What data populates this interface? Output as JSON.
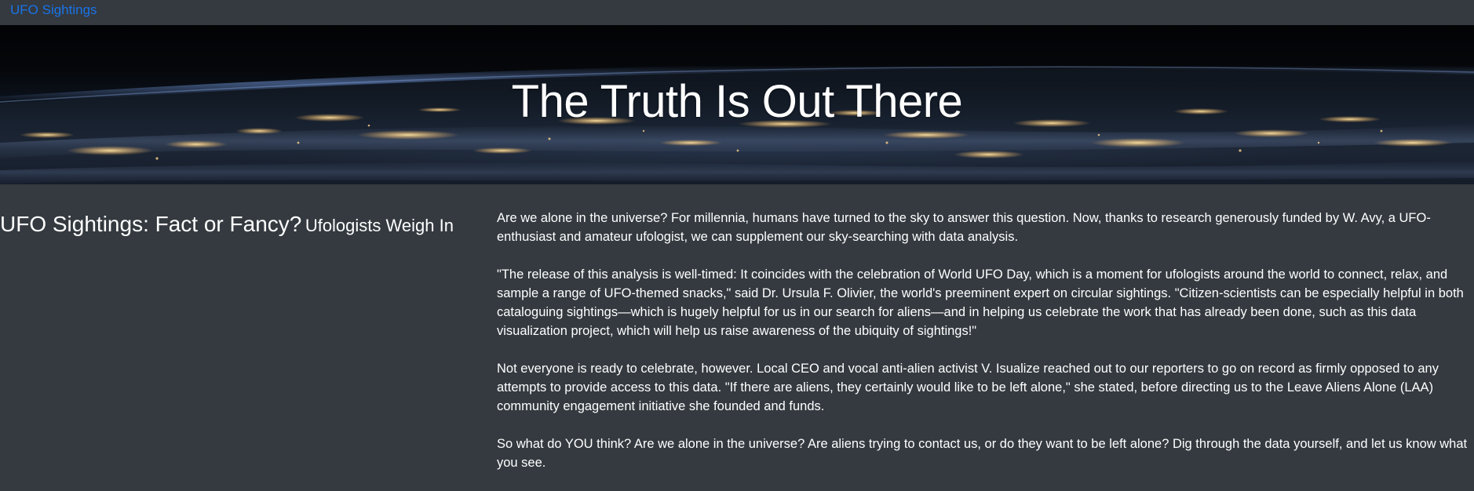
{
  "navbar": {
    "brand": "UFO Sightings"
  },
  "hero": {
    "title": "The Truth Is Out There"
  },
  "article": {
    "heading": "UFO Sightings: Fact or Fancy?",
    "subheading": "Ufologists Weigh In",
    "paragraphs": [
      "Are we alone in the universe? For millennia, humans have turned to the sky to answer this question. Now, thanks to research generously funded by W. Avy, a UFO-enthusiast and amateur ufologist, we can supplement our sky-searching with data analysis.",
      "\"The release of this analysis is well-timed: It coincides with the celebration of World UFO Day, which is a moment for ufologists around the world to connect, relax, and sample a range of UFO-themed snacks,\" said Dr. Ursula F. Olivier, the world's preeminent expert on circular sightings. \"Citizen-scientists can be especially helpful in both cataloguing sightings—which is hugely helpful for us in our search for aliens—and in helping us celebrate the work that has already been done, such as this data visualization project, which will help us raise awareness of the ubiquity of sightings!\"",
      "Not everyone is ready to celebrate, however. Local CEO and vocal anti-alien activist V. Isualize reached out to our reporters to go on record as firmly opposed to any attempts to provide access to this data. \"If there are aliens, they certainly would like to be left alone,\" she stated, before directing us to the Leave Aliens Alone (LAA) community engagement initiative she founded and funds.",
      "So what do YOU think? Are we alone in the universe? Are aliens trying to contact us, or do they want to be left alone? Dig through the data yourself, and let us know what you see."
    ]
  }
}
